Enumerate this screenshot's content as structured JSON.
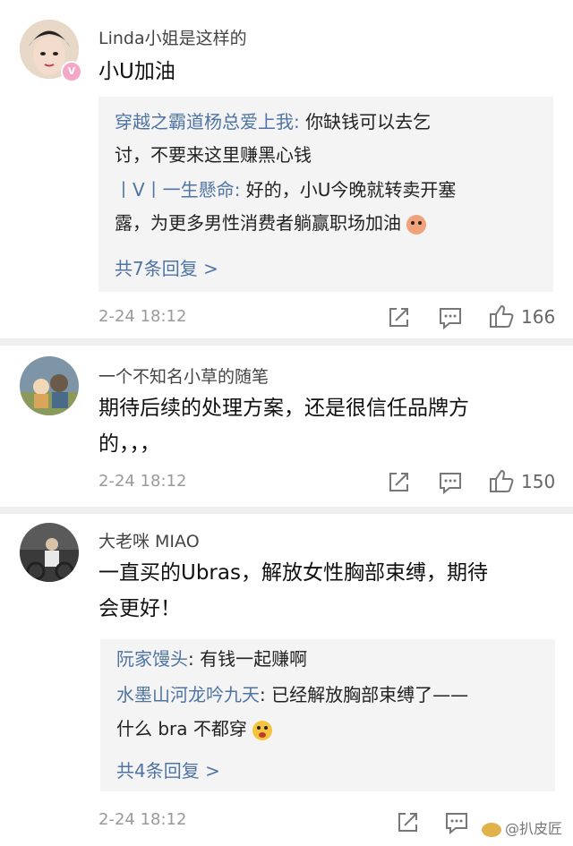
{
  "comments": [
    {
      "username": "Linda小姐是这样的",
      "text": "小U加油",
      "replies": [
        {
          "name": "穿越之霸道杨总爱上我",
          "sep": ": ",
          "text_l1": "你缺钱可以去乞",
          "text_l2": "讨，不要来这里赚黑心钱"
        },
        {
          "name": "丨V丨一生懸命",
          "sep": ": ",
          "text_l1": "好的，小U今晚就转卖开塞",
          "text_l2": "露，为更多男性消费者躺赢职场加油"
        }
      ],
      "more": "共7条回复 >",
      "time": "2-24 18:12",
      "likes": "166"
    },
    {
      "username": "一个不知名小草的随笔",
      "text_l1": "期待后续的处理方案，还是很信任品牌方",
      "text_l2": "的，，，",
      "time": "2-24 18:12",
      "likes": "150"
    },
    {
      "username": "大老咪 MIAO",
      "text_l1": "一直买的Ubras，解放女性胸部束缚，期待",
      "text_l2": "会更好！",
      "replies": [
        {
          "name": "阮家馒头",
          "sep": ": ",
          "text_l1": "有钱一起赚啊"
        },
        {
          "name": "水墨山河龙吟九天",
          "sep": ": ",
          "text_l1": "已经解放胸部束缚了——",
          "text_l2": "什么 bra 不都穿"
        }
      ],
      "more": "共4条回复 >",
      "time": "2-24 18:12"
    }
  ],
  "watermark": "@扒皮匠",
  "icons": [
    "share-icon",
    "comment-icon",
    "like-icon",
    "verified-badge-icon",
    "emoji-icon"
  ],
  "colors": {
    "link": "#4f74a4",
    "reply_bg": "#f4f4f4",
    "badge": "#f4a8c6"
  }
}
